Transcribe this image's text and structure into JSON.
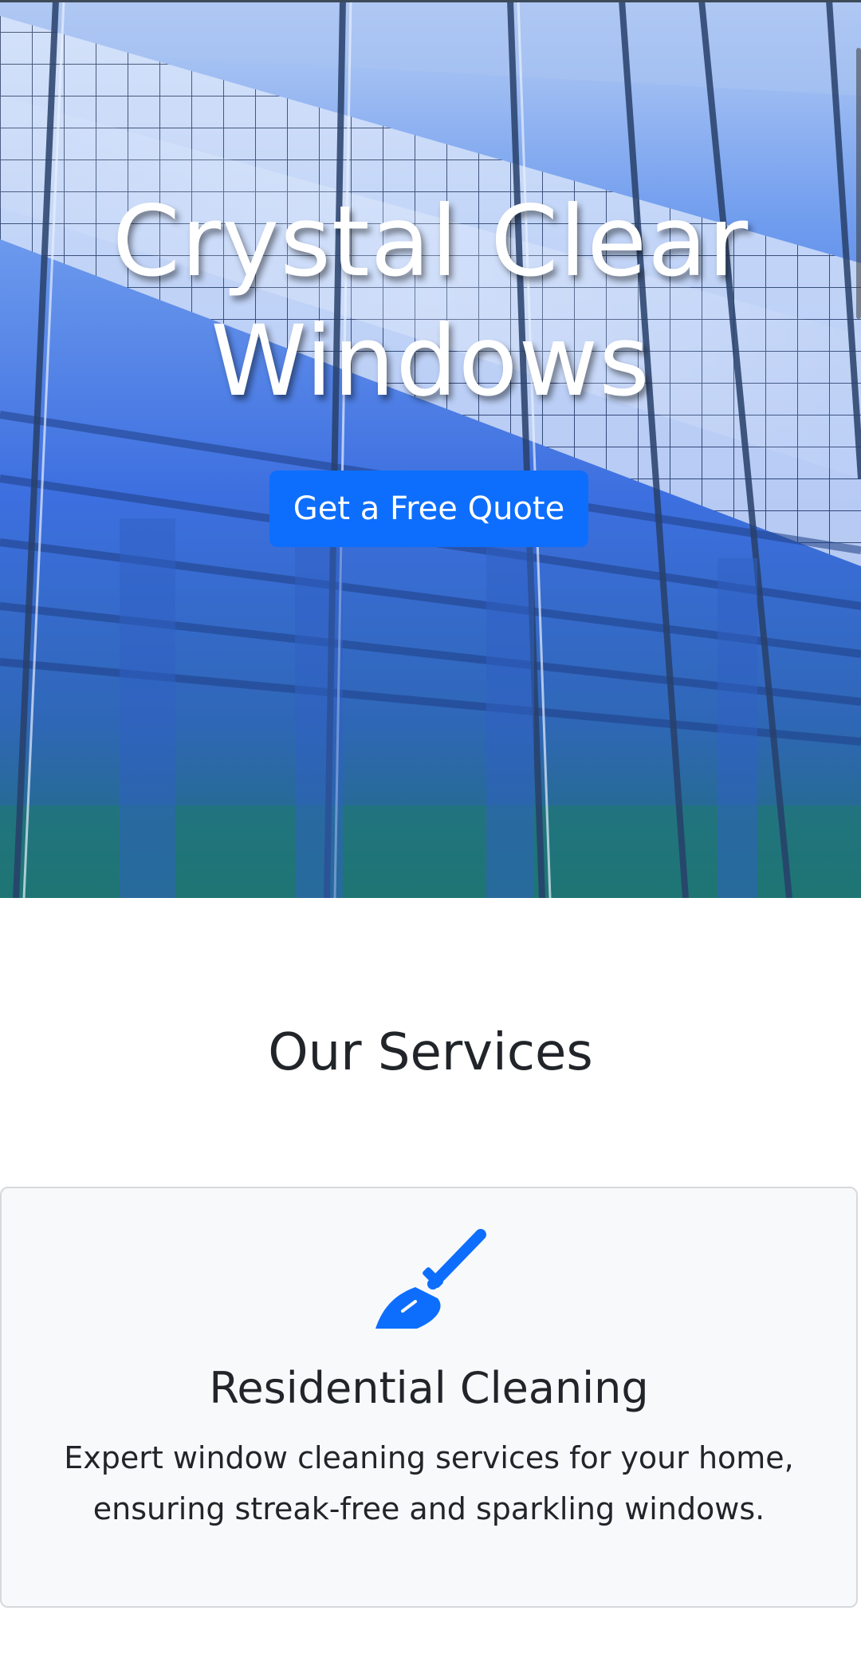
{
  "hero": {
    "title": "Crystal Clear Windows",
    "cta_label": "Get a Free Quote",
    "background_image": "glass-building-facade"
  },
  "services": {
    "heading": "Our Services",
    "items": [
      {
        "icon": "broom-icon",
        "title": "Residential Cleaning",
        "description": "Expert window cleaning services for your home, ensuring streak-free and sparkling windows."
      }
    ]
  },
  "colors": {
    "accent": "#0d6efd",
    "text": "#212529",
    "card_background": "#f8f9fa",
    "card_border": "#d7d9dc"
  }
}
